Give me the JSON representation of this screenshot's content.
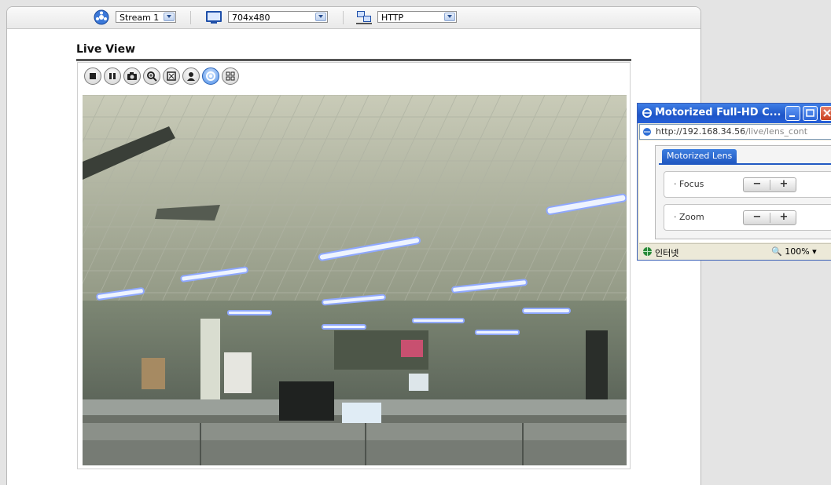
{
  "toolbar": {
    "stream_select": "Stream 1",
    "resolution_select": "704x480",
    "protocol_select": "HTTP"
  },
  "main": {
    "title": "Live View",
    "controls": [
      "stop-icon",
      "pause-icon",
      "snapshot-icon",
      "zoom-in-icon",
      "fullscreen-icon",
      "record-icon",
      "ptz-icon",
      "lens-control-icon"
    ]
  },
  "popup": {
    "title": "Motorized Full-HD C...",
    "url_host": "http://192.168.34.56",
    "url_path": "/live/lens_cont",
    "tab": "Motorized Lens",
    "focus_label": "Focus",
    "zoom_label": "Zoom",
    "minus": "−",
    "plus": "+",
    "status_zone": "인터넷",
    "status_zoom": "100%"
  },
  "colors": {
    "accent": "#2159c2",
    "title_bar": "#1e55c8"
  }
}
